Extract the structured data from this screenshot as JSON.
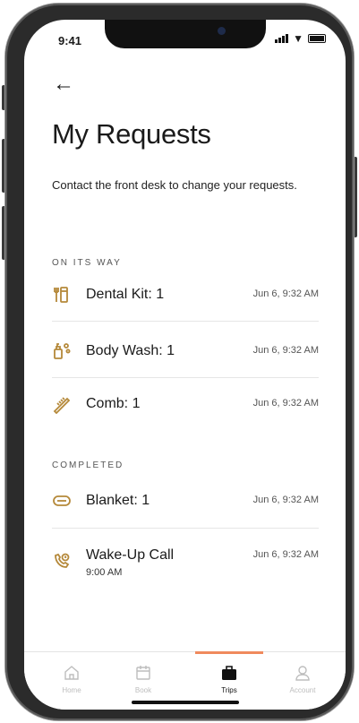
{
  "status": {
    "time": "9:41"
  },
  "header": {
    "back_icon": "arrow-left-icon",
    "title": "My Requests"
  },
  "description": "Contact the front desk to change your requests.",
  "accent_color": "#b5893a",
  "sections": [
    {
      "heading": "ON ITS WAY",
      "items": [
        {
          "icon": "dental-kit-icon",
          "label": "Dental Kit: 1",
          "time": "Jun 6, 9:32 AM"
        },
        {
          "icon": "body-wash-icon",
          "label": "Body Wash: 1",
          "time": "Jun 6, 9:32 AM"
        },
        {
          "icon": "comb-icon",
          "label": "Comb: 1",
          "time": "Jun 6, 9:32 AM"
        }
      ]
    },
    {
      "heading": "COMPLETED",
      "items": [
        {
          "icon": "blanket-icon",
          "label": "Blanket: 1",
          "time": "Jun 6, 9:32 AM"
        },
        {
          "icon": "wake-up-call-icon",
          "label": "Wake-Up Call",
          "sub": "9:00 AM",
          "time": "Jun 6, 9:32 AM"
        }
      ]
    }
  ],
  "tabs": [
    {
      "label": "Home",
      "icon": "home-icon",
      "active": false
    },
    {
      "label": "Book",
      "icon": "calendar-icon",
      "active": false
    },
    {
      "label": "Trips",
      "icon": "suitcase-icon",
      "active": true
    },
    {
      "label": "Account",
      "icon": "user-icon",
      "active": false
    }
  ]
}
